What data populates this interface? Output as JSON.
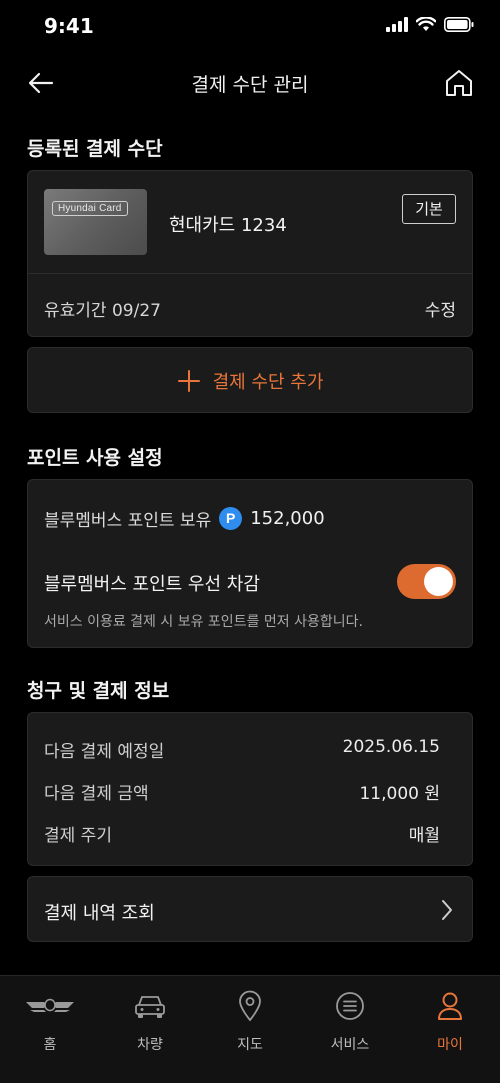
{
  "status_bar": {
    "time": "9:41"
  },
  "nav": {
    "title": "결제 수단 관리"
  },
  "registered": {
    "section_title": "등록된 결제 수단",
    "card_brand": "Hyundai Card",
    "card_name": "현대카드 1234",
    "default_badge": "기본",
    "expiry": "유효기간 09/27",
    "edit_label": "수정"
  },
  "add_button": {
    "label": "결제 수단 추가"
  },
  "points": {
    "section_title": "포인트 사용 설정",
    "balance_label": "블루멤버스 포인트 보유",
    "badge": "P",
    "balance_value": "152,000",
    "priority_label": "블루멤버스 포인트 우선 차감",
    "priority_enabled": true,
    "priority_desc": "서비스 이용료 결제 시 보유 포인트를 먼저 사용합니다."
  },
  "billing": {
    "section_title": "청구 및 결제 정보",
    "rows": [
      {
        "label": "다음 결제 예정일",
        "value": "2025.06.15"
      },
      {
        "label": "다음 결제 금액",
        "value": "11,000 원"
      },
      {
        "label": "결제 주기",
        "value": "매월"
      }
    ]
  },
  "history": {
    "label": "결제 내역 조회"
  },
  "tabs": [
    {
      "label": "홈",
      "icon": "genesis-logo-icon",
      "active": false
    },
    {
      "label": "차량",
      "icon": "car-icon",
      "active": false
    },
    {
      "label": "지도",
      "icon": "map-pin-icon",
      "active": false
    },
    {
      "label": "서비스",
      "icon": "menu-circle-icon",
      "active": false
    },
    {
      "label": "마이",
      "icon": "user-icon",
      "active": true
    }
  ],
  "colors": {
    "accent": "#E8763A",
    "points_badge": "#2F8DF0",
    "surface": "#1B1B1B",
    "background": "#000000"
  }
}
